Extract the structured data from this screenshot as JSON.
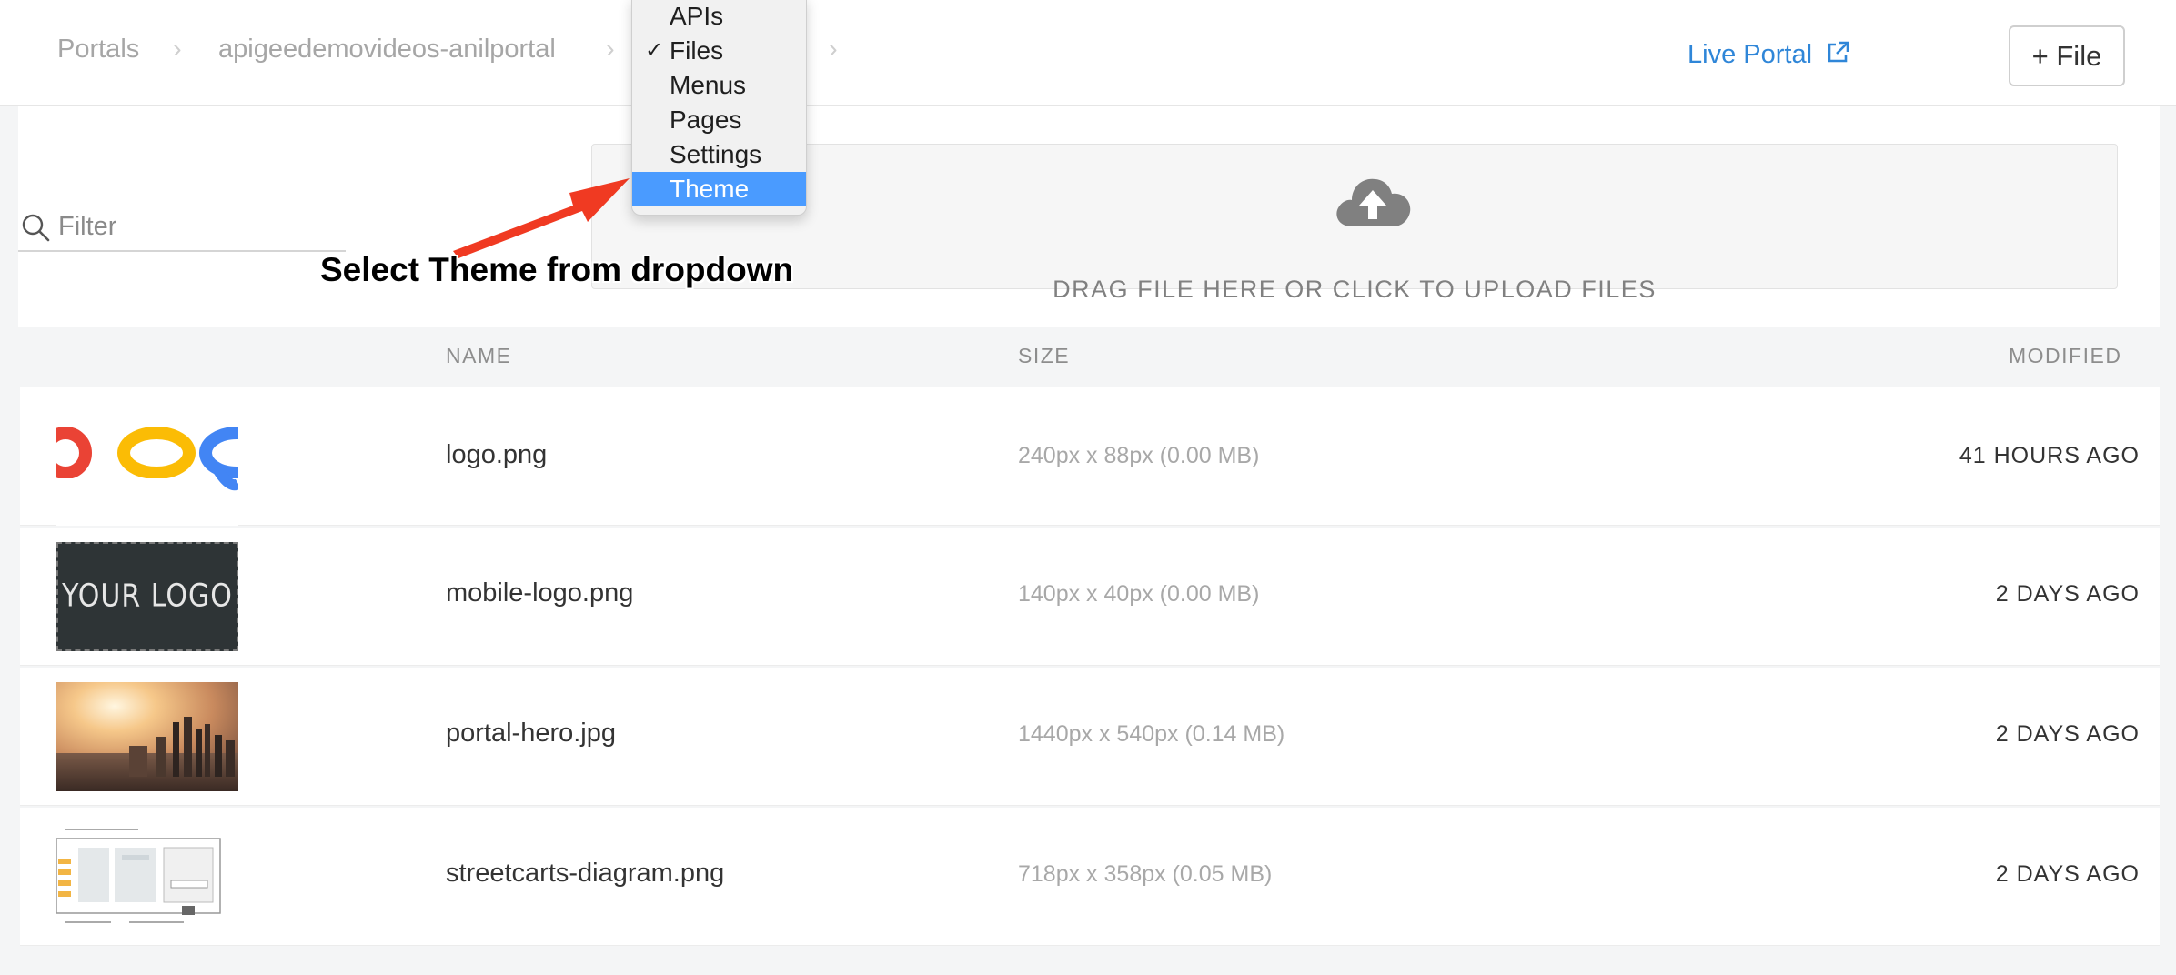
{
  "breadcrumb": {
    "items": [
      "Portals",
      "apigeedemovideos-anilportal"
    ]
  },
  "header": {
    "live_portal_label": "Live Portal",
    "add_file_label": "+ File"
  },
  "upload": {
    "filter_placeholder": "Filter",
    "dropzone_text": "DRAG FILE HERE OR CLICK TO UPLOAD FILES"
  },
  "table": {
    "columns": {
      "name": "NAME",
      "size": "SIZE",
      "modified": "MODIFIED"
    },
    "rows": [
      {
        "name": "logo.png",
        "size": "240px x 88px (0.00 MB)",
        "modified": "41 HOURS AGO"
      },
      {
        "name": "mobile-logo.png",
        "size": "140px x 40px (0.00 MB)",
        "modified": "2 DAYS AGO",
        "thumb_text": "YOUR LOGO"
      },
      {
        "name": "portal-hero.jpg",
        "size": "1440px x 540px (0.14 MB)",
        "modified": "2 DAYS AGO"
      },
      {
        "name": "streetcarts-diagram.png",
        "size": "718px x 358px (0.05 MB)",
        "modified": "2 DAYS AGO"
      }
    ]
  },
  "dropdown": {
    "items": [
      {
        "label": "APIs",
        "checked": false,
        "highlighted": false
      },
      {
        "label": "Files",
        "checked": true,
        "highlighted": false
      },
      {
        "label": "Menus",
        "checked": false,
        "highlighted": false
      },
      {
        "label": "Pages",
        "checked": false,
        "highlighted": false
      },
      {
        "label": "Settings",
        "checked": false,
        "highlighted": false
      },
      {
        "label": "Theme",
        "checked": false,
        "highlighted": true
      }
    ]
  },
  "annotation": {
    "text": "Select Theme from dropdown"
  },
  "icons": {
    "search": "search-icon",
    "upload": "cloud-upload-icon",
    "external_link": "external-link-icon",
    "chevron": "chevron-right-icon",
    "check": "checkmark-icon"
  },
  "colors": {
    "accent": "#2f86d8",
    "menu_highlight": "#4a9bff",
    "arrow": "#f03a22"
  }
}
